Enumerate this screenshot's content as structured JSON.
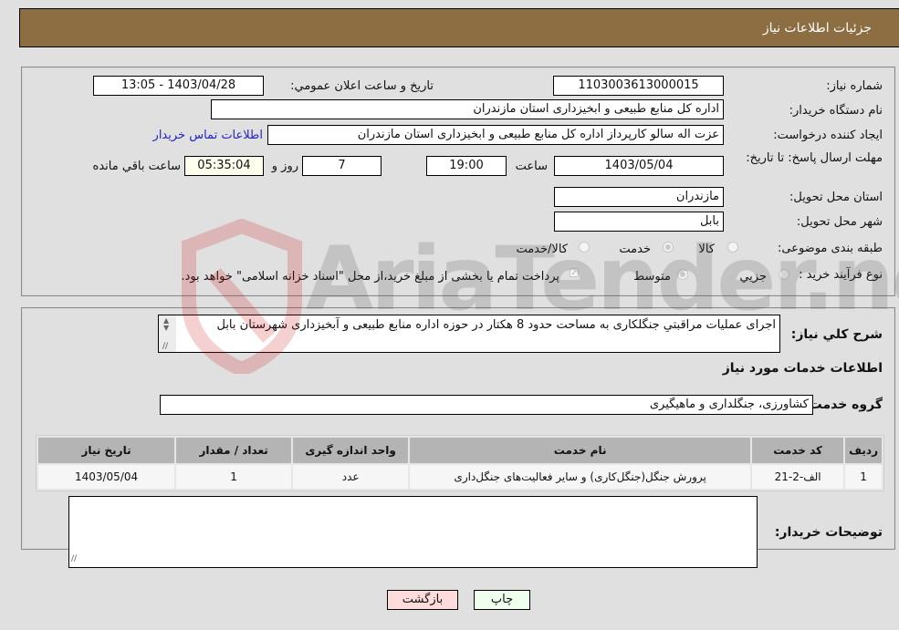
{
  "header": {
    "title": "جزئیات اطلاعات نیاز"
  },
  "form": {
    "need_number": {
      "label": "شماره نیاز:",
      "value": "1103003613000015"
    },
    "announce_datetime": {
      "label": "تاریخ و ساعت اعلان عمومي:",
      "value": "1403/04/28 - 13:05"
    },
    "buyer_org": {
      "label": "نام دستگاه خريدار:",
      "value": "اداره کل منابع طبیعی و ابخیزداری استان مازندران"
    },
    "requester": {
      "label": "ایجاد کننده درخواست:",
      "value": "عزت اله سالو کارپرداز اداره کل منابع طبیعی و ابخیزداری استان مازندران"
    },
    "buyer_contact_link": "اطلاعات تماس خریدار",
    "deadline": {
      "label": "مهلت ارسال پاسخ: تا تاریخ:",
      "date": "1403/05/04",
      "time_label": "ساعت",
      "time": "19:00",
      "days": "7",
      "days_label": "روز و",
      "remaining": "05:35:04",
      "remaining_label": "ساعت باقي مانده"
    },
    "province": {
      "label": "استان محل تحویل:",
      "value": "مازندران"
    },
    "city": {
      "label": "شهر محل تحویل:",
      "value": "بابل"
    },
    "category": {
      "label": "طبقه بندی موضوعی:",
      "options": [
        "کالا",
        "خدمت",
        "کالا/خدمت"
      ],
      "selected": "خدمت"
    },
    "purchase_process": {
      "label": "نوع فرآیند خرید :",
      "options": [
        "جزيي",
        "متوسط"
      ],
      "selected": "متوسط",
      "note": "پرداخت تمام یا بخشی از مبلغ خرید،از محل \"اسناد خزانه اسلامی\" خواهد بود."
    }
  },
  "description": {
    "label": "شرح کلي نياز:",
    "value": "اجرای عملیات مراقبتیِ جنگلکاری به مساحت حدود 8 هکتار در حوزه اداره منابع طبیعی و آبخیزداری شهرستان بابل"
  },
  "services": {
    "section_title": "اطلاعات خدمات مورد نياز",
    "group_label": "گروه خدمت:",
    "group_value": "کشاورزی، جنگلداری و ماهیگیری",
    "table": {
      "headers": [
        "رديف",
        "کد خدمت",
        "نام خدمت",
        "واحد اندازه گیری",
        "تعداد / مقدار",
        "تاريخ نياز"
      ],
      "rows": [
        [
          "1",
          "الف-2-21",
          "پرورش جنگل(جنگل‌کاری) و سایر فعالیت‌های جنگل‌داری",
          "عدد",
          "1",
          "1403/05/04"
        ]
      ]
    }
  },
  "buyer_notes": {
    "label": "توضیحات خریدار:",
    "value": ""
  },
  "buttons": {
    "print": "چاپ",
    "back": "بازگشت"
  },
  "watermark": {
    "text": "AriaTender.neT"
  }
}
